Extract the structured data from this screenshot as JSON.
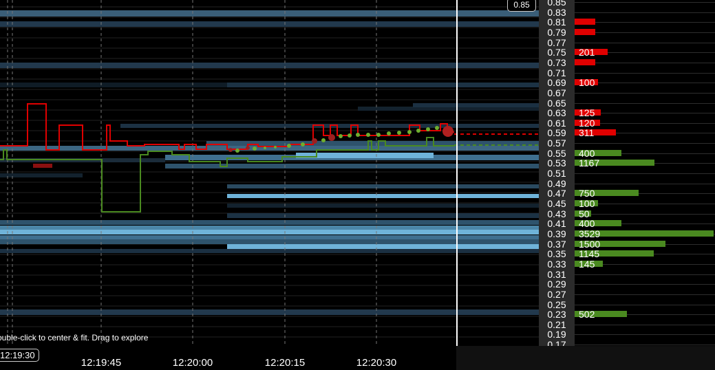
{
  "hint": "ouble-click to center & fit. Drag to explore",
  "cursor_time": "12:19:30",
  "cursor_price": "0.85",
  "time_axis": {
    "labels": [
      "12:19:45",
      "12:20:00",
      "12:20:15",
      "12:20:30"
    ]
  },
  "price_axis": {
    "ticks": [
      "0.85",
      "0.83",
      "0.81",
      "0.79",
      "0.77",
      "0.75",
      "0.73",
      "0.71",
      "0.69",
      "0.67",
      "0.65",
      "0.63",
      "0.61",
      "0.59",
      "0.57",
      "0.55",
      "0.53",
      "0.51",
      "0.49",
      "0.47",
      "0.45",
      "0.43",
      "0.41",
      "0.39",
      "0.37",
      "0.35",
      "0.33",
      "0.31",
      "0.29",
      "0.27",
      "0.25",
      "0.23",
      "0.21",
      "0.19",
      "0.17"
    ]
  },
  "order_book": [
    {
      "price": "0.81",
      "side": "ask",
      "size": ""
    },
    {
      "price": "0.79",
      "side": "ask",
      "size": ""
    },
    {
      "price": "0.75",
      "side": "ask",
      "size": "201"
    },
    {
      "price": "0.73",
      "side": "ask",
      "size": ""
    },
    {
      "price": "0.69",
      "side": "ask",
      "size": "100"
    },
    {
      "price": "0.63",
      "side": "ask",
      "size": "125"
    },
    {
      "price": "0.61",
      "side": "ask",
      "size": "120"
    },
    {
      "price": "0.59",
      "side": "ask",
      "size": "311"
    },
    {
      "price": "0.55",
      "side": "bid",
      "size": "400"
    },
    {
      "price": "0.53",
      "side": "bid",
      "size": "1167"
    },
    {
      "price": "0.47",
      "side": "bid",
      "size": "750"
    },
    {
      "price": "0.45",
      "side": "bid",
      "size": "100"
    },
    {
      "price": "0.43",
      "side": "bid",
      "size": "50"
    },
    {
      "price": "0.41",
      "side": "bid",
      "size": "400"
    },
    {
      "price": "0.39",
      "side": "bid",
      "size": "3529"
    },
    {
      "price": "0.37",
      "side": "bid",
      "size": "1500"
    },
    {
      "price": "0.35",
      "side": "bid",
      "size": "1145"
    },
    {
      "price": "0.33",
      "side": "bid",
      "size": "145"
    },
    {
      "price": "0.23",
      "side": "bid",
      "size": "502"
    }
  ],
  "colors": {
    "ask": "#e00000",
    "bid": "#4a8a20",
    "heat_light": "#6fb3d9",
    "heat_mid": "#3f6f8f",
    "heat_dark": "#1b3347"
  }
}
